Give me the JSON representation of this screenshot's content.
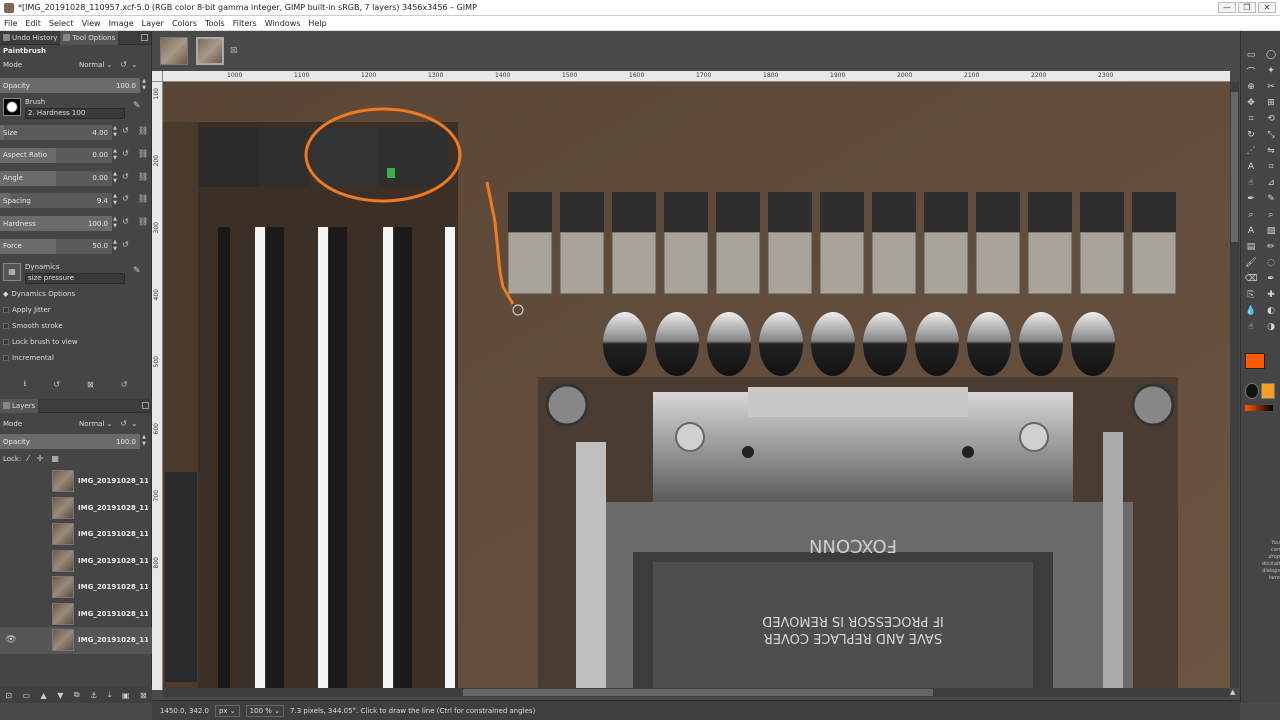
{
  "window": {
    "title": "*[IMG_20191028_110957.xcf-5.0 (RGB color 8-bit gamma integer, GIMP built-in sRGB, 7 layers) 3456x3456 – GIMP",
    "minimize": "—",
    "maximize": "❐",
    "close": "✕"
  },
  "menu": [
    "File",
    "Edit",
    "Select",
    "View",
    "Image",
    "Layer",
    "Colors",
    "Tools",
    "Filters",
    "Windows",
    "Help"
  ],
  "tool_options": {
    "tabs": [
      "Undo History",
      "Tool Options"
    ],
    "tool_name": "Paintbrush",
    "mode_label": "Mode",
    "mode_value": "Normal",
    "opacity_label": "Opacity",
    "opacity_value": "100.0",
    "brush_label": "Brush",
    "brush_name": "2. Hardness 100",
    "sliders": [
      {
        "label": "Size",
        "value": "4.00",
        "fraction": 0.04
      },
      {
        "label": "Aspect Ratio",
        "value": "0.00",
        "fraction": 0.5
      },
      {
        "label": "Angle",
        "value": "0.00",
        "fraction": 0.5
      },
      {
        "label": "Spacing",
        "value": "9.4",
        "fraction": 0.09
      },
      {
        "label": "Hardness",
        "value": "100.0",
        "fraction": 1.0
      },
      {
        "label": "Force",
        "value": "50.0",
        "fraction": 0.5
      }
    ],
    "dynamics_label": "Dynamics",
    "dynamics_name": "size pressure",
    "dynamics_options": "Dynamics Options",
    "checks": [
      {
        "label": "Apply Jitter",
        "checked": false
      },
      {
        "label": "Smooth stroke",
        "checked": false
      },
      {
        "label": "Lock brush to view",
        "checked": false
      },
      {
        "label": "Incremental",
        "checked": false
      }
    ]
  },
  "layers": {
    "tab": "Layers",
    "mode_label": "Mode",
    "mode_value": "Normal",
    "opacity_label": "Opacity",
    "opacity_value": "100.0",
    "lock_label": "Lock:",
    "items": [
      "IMG_20191028_11",
      "IMG_20191028_11",
      "IMG_20191028_11",
      "IMG_20191028_11",
      "IMG_20191028_11",
      "IMG_20191028_11",
      "IMG_20191028_11"
    ]
  },
  "ruler": {
    "h_ticks": [
      "1000",
      "1100",
      "1200",
      "1300",
      "1400",
      "1500",
      "1600",
      "1700",
      "1800",
      "1900",
      "2000",
      "2100",
      "2200",
      "2300"
    ],
    "v_ticks": [
      "100",
      "200",
      "300",
      "400",
      "500",
      "600",
      "700",
      "800"
    ]
  },
  "status": {
    "coords": "1450.0, 342.0",
    "unit": "px",
    "zoom": "100 %",
    "message": "7.3 pixels, 344.05°. Click to draw the line (Ctrl for constrained angles)"
  },
  "colors": {
    "foreground": "#ff5a00",
    "background": "#000000",
    "annotation": "#f07a20"
  },
  "side_hint": "You can drop dockable dialogs here"
}
